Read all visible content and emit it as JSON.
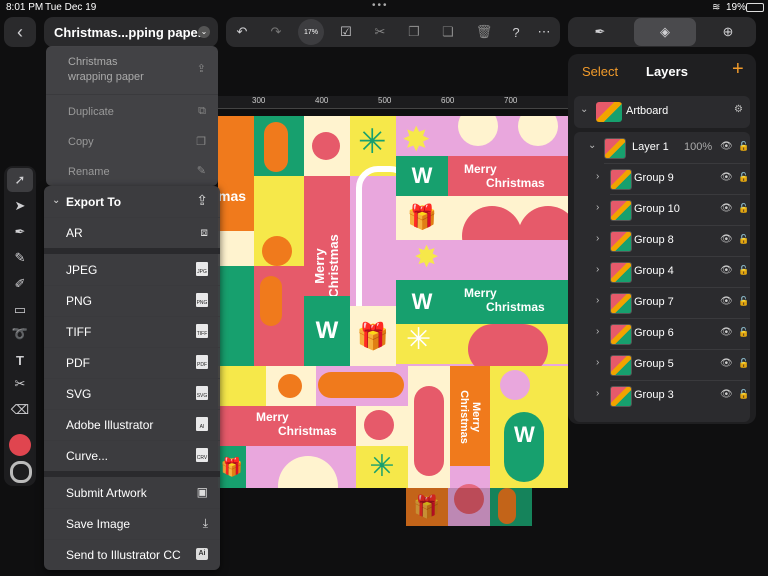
{
  "status": {
    "time": "8:01 PM",
    "date": "Tue Dec 19",
    "battery": "19%"
  },
  "document": {
    "title": "Christmas...pping paper",
    "zoom": "17%"
  },
  "doc_menu": {
    "name_line1": "Christmas",
    "name_line2": "wrapping paper",
    "items": [
      "Duplicate",
      "Copy",
      "Rename"
    ]
  },
  "export_menu": {
    "header": "Export To",
    "items": [
      {
        "label": "AR",
        "icon": "ar-icon"
      },
      {
        "label": "JPEG",
        "icon": "jpg-file-icon",
        "badge": "JPG"
      },
      {
        "label": "PNG",
        "icon": "png-file-icon",
        "badge": "PNG"
      },
      {
        "label": "TIFF",
        "icon": "tiff-file-icon",
        "badge": "TIFF"
      },
      {
        "label": "PDF",
        "icon": "pdf-file-icon",
        "badge": "PDF"
      },
      {
        "label": "SVG",
        "icon": "svg-file-icon",
        "badge": "SVG"
      },
      {
        "label": "Adobe Illustrator",
        "icon": "ai-file-icon",
        "badge": "AI"
      },
      {
        "label": "Curve...",
        "icon": "crv-file-icon",
        "badge": "CRV"
      },
      {
        "label": "Submit Artwork",
        "icon": "gallery-icon"
      },
      {
        "label": "Save Image",
        "icon": "save-image-icon"
      },
      {
        "label": "Send to Illustrator CC",
        "icon": "illustrator-icon",
        "badge": "Ai"
      }
    ]
  },
  "ruler": {
    "marks": [
      "300",
      "400",
      "500",
      "600",
      "700"
    ]
  },
  "artwork": {
    "text1": "Merry",
    "text2": "Christmas",
    "fragment": "mas"
  },
  "layers_panel": {
    "select_label": "Select",
    "title": "Layers",
    "add_label": "+",
    "artboard": "Artboard",
    "layer1": {
      "name": "Layer 1",
      "opacity": "100%"
    },
    "groups": [
      "Group 9",
      "Group 10",
      "Group 8",
      "Group 4",
      "Group 7",
      "Group 6",
      "Group 5",
      "Group 3"
    ]
  },
  "colors": {
    "fill": "#e0454f",
    "accent": "#f29b2b",
    "canvas_red": "#e65a6a",
    "canvas_green": "#17a06e",
    "canvas_pink": "#e9a7dd",
    "canvas_yellow": "#f6e84a",
    "canvas_orange": "#f07a1c"
  }
}
